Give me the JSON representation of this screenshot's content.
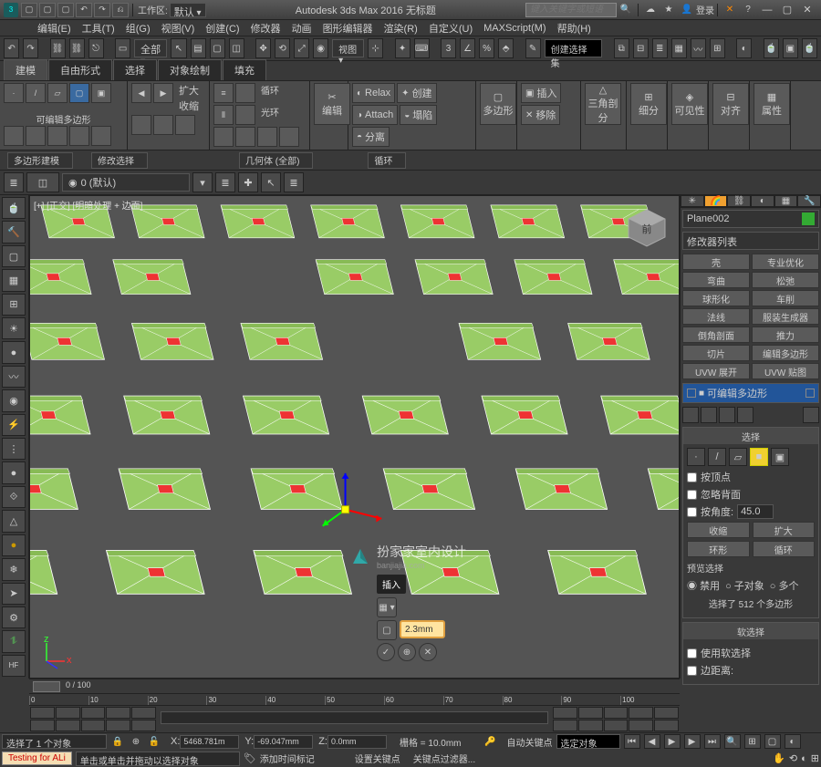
{
  "titlebar": {
    "workspace_label": "工作区: ",
    "workspace_value": "默认",
    "app_title": "Autodesk 3ds Max 2016   无标题",
    "search_placeholder": "键入关键字或短语",
    "login": "登录"
  },
  "menubar": [
    "编辑(E)",
    "工具(T)",
    "组(G)",
    "视图(V)",
    "创建(C)",
    "修改器",
    "动画",
    "图形编辑器",
    "渲染(R)",
    "自定义(U)",
    "MAXScript(M)",
    "帮助(H)"
  ],
  "toolbar1": {
    "dropdown": "全部",
    "create_set": "创建选择集"
  },
  "ribbon_tabs": [
    "建模",
    "自由形式",
    "选择",
    "对象绘制",
    "填充"
  ],
  "ribbon": {
    "g1_label": "可编辑多边形",
    "g2_expand": "扩大",
    "g2_shrink": "收缩",
    "g3_loop": "循环",
    "g3_ring": "光环",
    "g4_edit": "编辑",
    "g5_relax": "Relax",
    "g5_attach": "Attach",
    "g5_sep": "分离",
    "g5_create": "创建",
    "g5_collapse": "塌陷",
    "g6_poly": "多边形",
    "g7_insert": "插入",
    "g7_move": "移除",
    "g8_tri": "三角剖分",
    "g9_sub": "细分",
    "g10_vis": "可见性",
    "g11_align": "对齐",
    "g12_prop": "属性"
  },
  "ribbon_sub": {
    "s1": "多边形建模",
    "s2": "修改选择",
    "s3": "几何体 (全部)",
    "s4": "循环"
  },
  "layerbar": {
    "layer": "0 (默认)"
  },
  "viewport": {
    "label": "[+] [正交] [明暗处理 + 边面]",
    "caddy_label": "插入",
    "caddy_value": "2.3mm"
  },
  "watermark": {
    "title": "扮家家室内设计",
    "url": "banjiajia.com"
  },
  "rpanel": {
    "object_name": "Plane002",
    "modlist_label": "修改器列表",
    "mods": [
      "壳",
      "专业优化",
      "弯曲",
      "松弛",
      "球形化",
      "车削",
      "法线",
      "服装生成器",
      "倒角剖面",
      "推力",
      "切片",
      "编辑多边形",
      "UVW 展开",
      "UVW 贴图"
    ],
    "stack_item": "可编辑多边形",
    "roll_select": "选择",
    "chk_vertex": "按顶点",
    "chk_ignore": "忽略背面",
    "chk_angle": "按角度:",
    "angle_val": "45.0",
    "btn_shrink": "收缩",
    "btn_grow": "扩大",
    "btn_ring": "环形",
    "btn_loop": "循环",
    "preview": "预览选择",
    "r_off": "禁用",
    "r_sub": "子对象",
    "r_multi": "多个",
    "sel_count": "选择了 512 个多边形",
    "roll_soft": "软选择",
    "chk_soft": "使用软选择",
    "chk_edge": "边距离:"
  },
  "timeline": {
    "range": "0 / 100",
    "ticks": [
      "0",
      "10",
      "20",
      "30",
      "40",
      "50",
      "60",
      "70",
      "80",
      "90",
      "100"
    ]
  },
  "statusbar": {
    "selected": "选择了 1 个对象",
    "x": "5468.781m",
    "y": "-69.047mm",
    "z": "0.0mm",
    "grid": "栅格 = 10.0mm",
    "auto_key": "自动关键点",
    "set_key": "设置关键点",
    "filter": "选定对象",
    "key_filter": "关键点过滤器...",
    "test": "Testing for ALi",
    "prompt": "单击或单击并拖动以选择对象",
    "add_time": "添加时间标记"
  }
}
